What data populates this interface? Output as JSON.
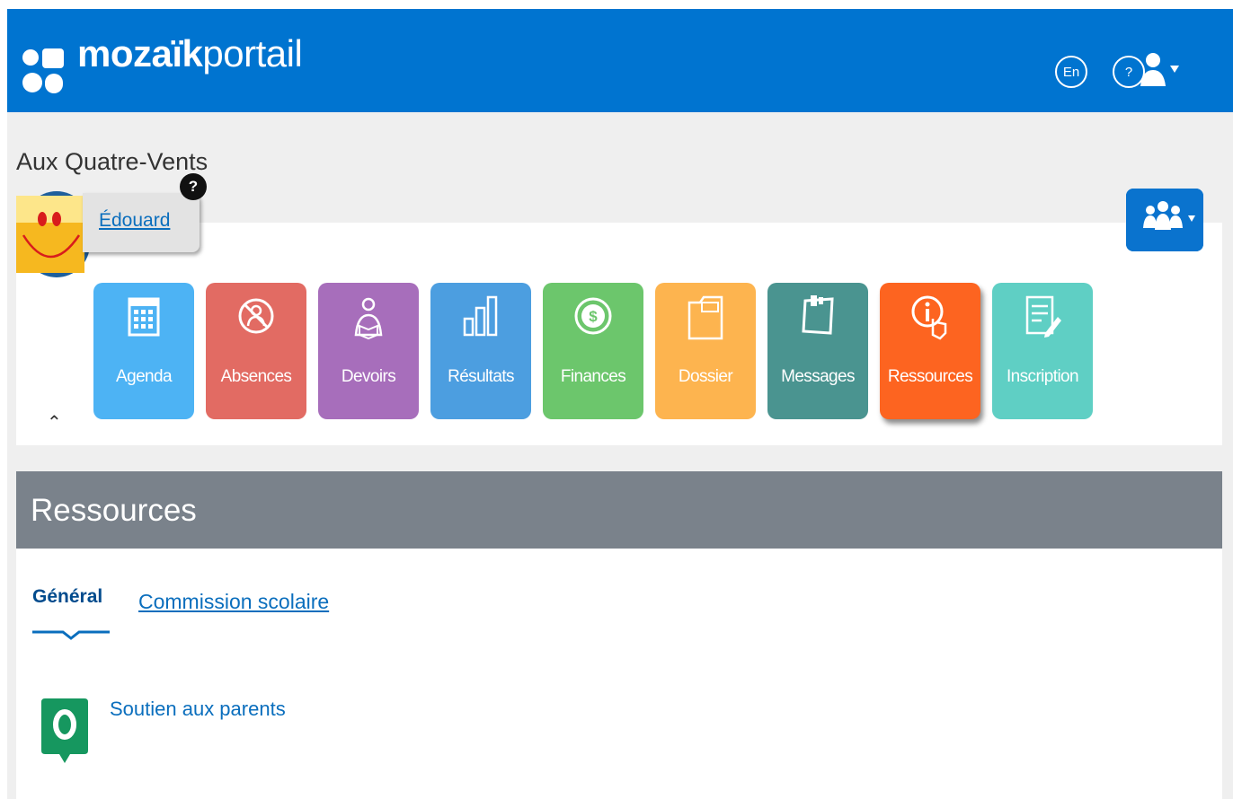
{
  "header": {
    "brand_bold": "mozaïk",
    "brand_light": "portail",
    "lang_button": "En",
    "help_button": "?"
  },
  "school_name": "Aux Quatre-Vents",
  "student": {
    "name": "Édouard",
    "help_badge": "?"
  },
  "modules": [
    {
      "label": "Agenda",
      "icon": "calendar-icon",
      "color": "#4db3f4"
    },
    {
      "label": "Absences",
      "icon": "no-person-icon",
      "color": "#e26b63"
    },
    {
      "label": "Devoirs",
      "icon": "reading-person-icon",
      "color": "#a76ebb"
    },
    {
      "label": "Résultats",
      "icon": "bar-chart-icon",
      "color": "#4c9ee0"
    },
    {
      "label": "Finances",
      "icon": "dollar-coin-icon",
      "color": "#6cc66c"
    },
    {
      "label": "Dossier",
      "icon": "folder-icon",
      "color": "#fdb44f"
    },
    {
      "label": "Messages",
      "icon": "note-icon",
      "color": "#4a9490"
    },
    {
      "label": "Ressources",
      "icon": "info-touch-icon",
      "color": "#fd6420",
      "active": true
    },
    {
      "label": "Inscription",
      "icon": "form-pen-icon",
      "color": "#5fcfc4"
    }
  ],
  "section": {
    "title": "Ressources"
  },
  "tabs": [
    {
      "label": "Général",
      "active": true
    },
    {
      "label": "Commission scolaire",
      "active": false
    }
  ],
  "resources": [
    {
      "label": "Soutien aux parents",
      "icon": "speech-o-icon",
      "color": "#16975f"
    }
  ],
  "colors": {
    "header": "#0074d0",
    "section_bar": "#7a828b",
    "link": "#0a6ebd"
  }
}
